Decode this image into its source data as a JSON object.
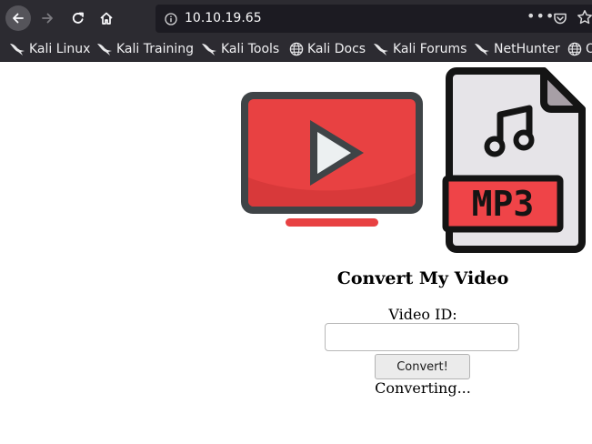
{
  "browser": {
    "url": "10.10.19.65",
    "more_label": "•••",
    "bookmarks": [
      {
        "label": "Kali Linux",
        "icon": "kali-dragon-icon"
      },
      {
        "label": "Kali Training",
        "icon": "kali-dragon-icon"
      },
      {
        "label": "Kali Tools",
        "icon": "kali-dragon-icon"
      },
      {
        "label": "Kali Docs",
        "icon": "globe-icon"
      },
      {
        "label": "Kali Forums",
        "icon": "kali-dragon-icon"
      },
      {
        "label": "NetHunter",
        "icon": "kali-dragon-icon"
      },
      {
        "label": "O",
        "icon": "globe-icon"
      }
    ]
  },
  "page": {
    "logo_text": "MP3",
    "heading": "Convert My Video",
    "video_label": "Video ID:",
    "video_input_value": "",
    "convert_button": "Convert!",
    "status": "Converting..."
  },
  "colors": {
    "chrome_bg": "#2c2b31",
    "urlbar_bg": "#1c1b22",
    "youtube_red": "#e84142",
    "mp3_red": "#ef4448"
  }
}
